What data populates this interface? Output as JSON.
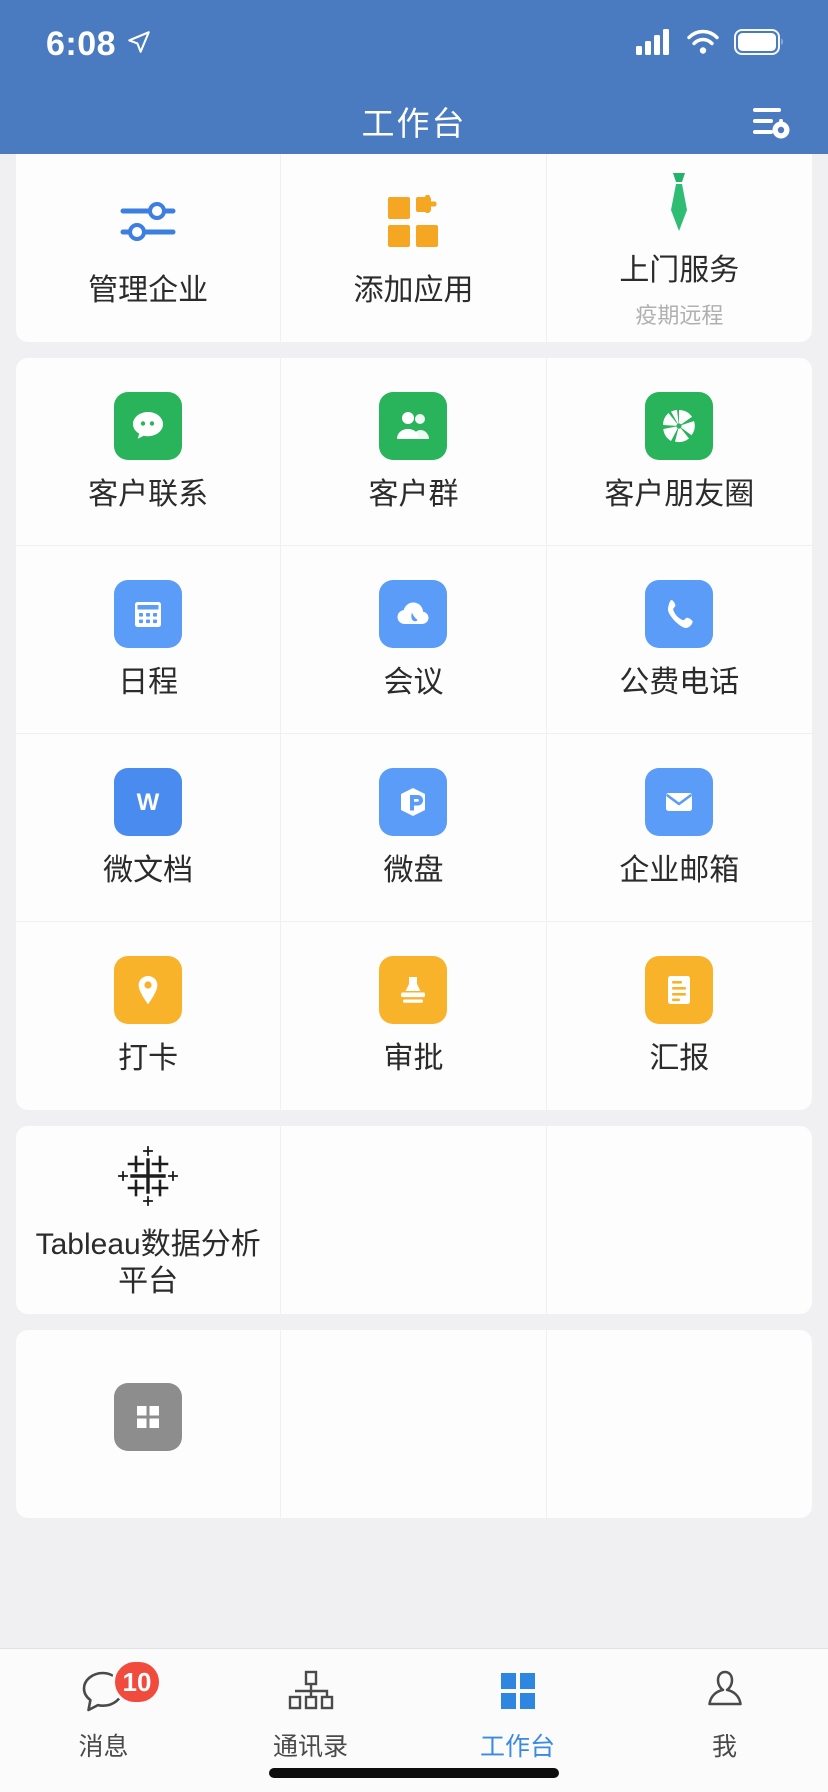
{
  "status_bar": {
    "time": "6:08",
    "location_icon": "location-arrow-icon",
    "signal_icon": "cellular-signal-icon",
    "wifi_icon": "wifi-icon",
    "battery_icon": "battery-icon"
  },
  "header": {
    "title": "工作台",
    "action_icon": "list-settings-icon"
  },
  "sections": [
    {
      "name": "quick-actions",
      "items": [
        {
          "label": "管理企业",
          "sub": "",
          "icon": "sliders-icon",
          "style": "line-blue"
        },
        {
          "label": "添加应用",
          "sub": "",
          "icon": "add-app-icon",
          "style": "plain-orange"
        },
        {
          "label": "上门服务",
          "sub": "疫期远程",
          "icon": "necktie-icon",
          "style": "plain-green"
        }
      ]
    },
    {
      "name": "apps",
      "items": [
        {
          "label": "客户联系",
          "sub": "",
          "icon": "chat-bubble-icon",
          "style": "green"
        },
        {
          "label": "客户群",
          "sub": "",
          "icon": "people-group-icon",
          "style": "green"
        },
        {
          "label": "客户朋友圈",
          "sub": "",
          "icon": "camera-shutter-icon",
          "style": "green"
        },
        {
          "label": "日程",
          "sub": "",
          "icon": "calendar-icon",
          "style": "blue"
        },
        {
          "label": "会议",
          "sub": "",
          "icon": "meeting-cloud-icon",
          "style": "blue"
        },
        {
          "label": "公费电话",
          "sub": "",
          "icon": "phone-icon",
          "style": "blue"
        },
        {
          "label": "微文档",
          "sub": "",
          "icon": "wedoc-w-icon",
          "style": "blue"
        },
        {
          "label": "微盘",
          "sub": "",
          "icon": "wedrive-cube-icon",
          "style": "blue"
        },
        {
          "label": "企业邮箱",
          "sub": "",
          "icon": "envelope-icon",
          "style": "blue"
        },
        {
          "label": "打卡",
          "sub": "",
          "icon": "location-pin-icon",
          "style": "orange"
        },
        {
          "label": "审批",
          "sub": "",
          "icon": "stamp-icon",
          "style": "orange"
        },
        {
          "label": "汇报",
          "sub": "",
          "icon": "report-doc-icon",
          "style": "orange"
        }
      ]
    },
    {
      "name": "third-party",
      "items": [
        {
          "label": "Tableau数据分析平台",
          "sub": "",
          "icon": "tableau-logo-icon",
          "style": "logo"
        }
      ]
    },
    {
      "name": "more-apps",
      "items": [
        {
          "label": "",
          "sub": "",
          "icon": "grid-windows-icon",
          "style": "gray"
        }
      ]
    }
  ],
  "tabbar": {
    "tabs": [
      {
        "label": "消息",
        "icon": "chat-outline-icon",
        "badge": "10",
        "active": false
      },
      {
        "label": "通讯录",
        "icon": "org-chart-icon",
        "badge": "",
        "active": false
      },
      {
        "label": "工作台",
        "icon": "grid-squares-icon",
        "badge": "",
        "active": true
      },
      {
        "label": "我",
        "icon": "person-icon",
        "badge": "",
        "active": false
      }
    ]
  },
  "colors": {
    "brand_blue": "#4a7ac0",
    "accent_blue": "#3c8ae0",
    "green": "#29b35b",
    "icon_blue": "#5a9cf8",
    "orange": "#f8b32b",
    "badge_red": "#f04b3c",
    "page_bg": "#f0f0f3"
  }
}
